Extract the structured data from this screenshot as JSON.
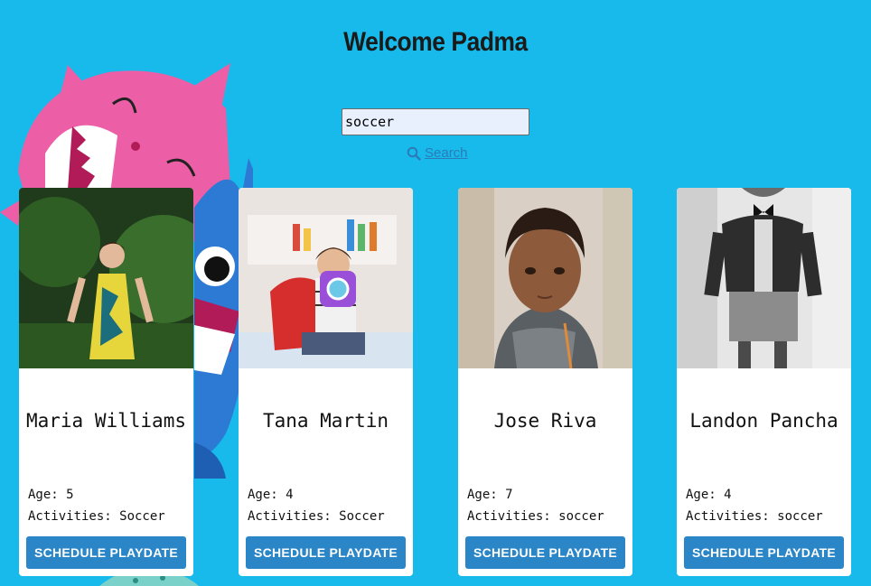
{
  "header": {
    "title": "Welcome Padma"
  },
  "search": {
    "value": "soccer",
    "button_label": "Search"
  },
  "colors": {
    "background": "#17baea",
    "button": "#2a86c7",
    "link": "#2b7bb9"
  },
  "kids": [
    {
      "name": "Maria Williams",
      "age_text": "Age: 5",
      "activities_text": "Activities: Soccer",
      "button_label": "SCHEDULE PLAYDATE"
    },
    {
      "name": "Tana Martin",
      "age_text": "Age: 4",
      "activities_text": "Activities: Soccer",
      "button_label": "SCHEDULE PLAYDATE"
    },
    {
      "name": "Jose Riva",
      "age_text": "Age: 7",
      "activities_text": "Activities: soccer",
      "button_label": "SCHEDULE PLAYDATE"
    },
    {
      "name": "Landon Pancha",
      "age_text": "Age: 4",
      "activities_text": "Activities: soccer",
      "button_label": "SCHEDULE PLAYDATE"
    }
  ]
}
